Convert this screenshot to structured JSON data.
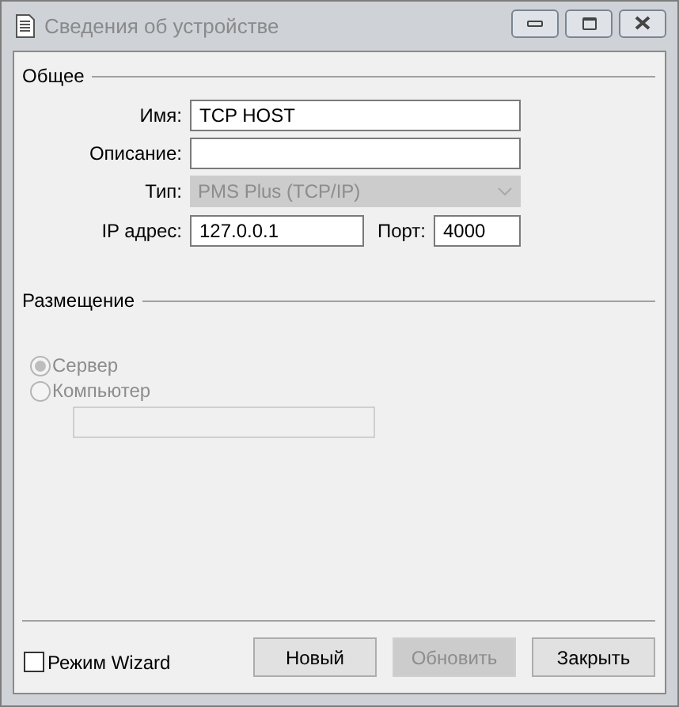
{
  "window": {
    "title": "Сведения об устройстве"
  },
  "general": {
    "label": "Общее",
    "name": {
      "label": "Имя:",
      "value": "TCP HOST"
    },
    "description": {
      "label": "Описание:"
    },
    "type": {
      "label": "Тип:",
      "value": "PMS Plus (TCP/IP)",
      "disabled": true
    },
    "ip": {
      "label": "IP адрес:",
      "value": "127.0.0.1"
    },
    "port": {
      "label": "Порт:",
      "value": "4000"
    }
  },
  "placement": {
    "label": "Размещение",
    "options": [
      {
        "label": "Сервер",
        "selected": true,
        "disabled": true
      },
      {
        "label": "Компьютер",
        "selected": false,
        "disabled": true
      }
    ]
  },
  "wizard": {
    "label": "Режим Wizard",
    "checked": false
  },
  "buttons": [
    {
      "label": "Новый",
      "disabled": false
    },
    {
      "label": "Обновить",
      "disabled": true
    },
    {
      "label": "Закрыть",
      "disabled": false
    }
  ]
}
